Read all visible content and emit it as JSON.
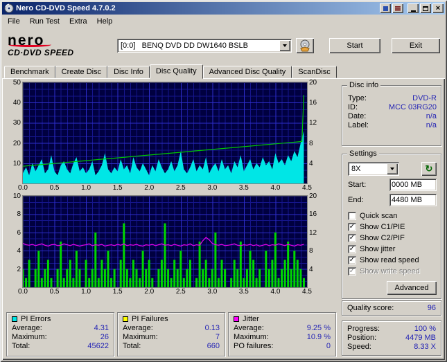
{
  "window": {
    "title": "Nero CD-DVD Speed 4.7.0.2",
    "menu": [
      "File",
      "Run Test",
      "Extra",
      "Help"
    ]
  },
  "header": {
    "logo_top": "nero",
    "logo_bottom": "CD·DVD SPEED",
    "drive": "[0:0]   BENQ DVD DD DW1640 BSLB",
    "start_label": "Start",
    "exit_label": "Exit"
  },
  "tabs": [
    "Benchmark",
    "Create Disc",
    "Disc Info",
    "Disc Quality",
    "Advanced Disc Quality",
    "ScanDisc"
  ],
  "active_tab": "Disc Quality",
  "disc_info": {
    "title": "Disc info",
    "rows": [
      [
        "Type:",
        "DVD-R"
      ],
      [
        "ID:",
        "MCC 03RG20"
      ],
      [
        "Date:",
        "n/a"
      ],
      [
        "Label:",
        "n/a"
      ]
    ]
  },
  "settings": {
    "title": "Settings",
    "speed": "8X",
    "start_label": "Start:",
    "start_value": "0000 MB",
    "end_label": "End:",
    "end_value": "4480 MB",
    "checkboxes": [
      {
        "label": "Quick scan",
        "checked": false,
        "disabled": false
      },
      {
        "label": "Show C1/PIE",
        "checked": true,
        "disabled": false
      },
      {
        "label": "Show C2/PIF",
        "checked": true,
        "disabled": false
      },
      {
        "label": "Show jitter",
        "checked": true,
        "disabled": false
      },
      {
        "label": "Show read speed",
        "checked": true,
        "disabled": false
      },
      {
        "label": "Show write speed",
        "checked": true,
        "disabled": true
      }
    ],
    "advanced_label": "Advanced"
  },
  "quality": {
    "label": "Quality score:",
    "value": "96"
  },
  "progress": {
    "rows": [
      [
        "Progress:",
        "100 %"
      ],
      [
        "Position:",
        "4479 MB"
      ],
      [
        "Speed:",
        "8.33 X"
      ]
    ]
  },
  "stats": [
    {
      "color": "#00e6e6",
      "title": "PI Errors",
      "rows": [
        [
          "Average:",
          "4.31"
        ],
        [
          "Maximum:",
          "26"
        ],
        [
          "Total:",
          "45622"
        ]
      ]
    },
    {
      "color": "#ffff00",
      "title": "PI Failures",
      "rows": [
        [
          "Average:",
          "0.13"
        ],
        [
          "Maximum:",
          "7"
        ],
        [
          "Total:",
          "660"
        ]
      ]
    },
    {
      "color": "#ff00ff",
      "title": "Jitter",
      "rows": [
        [
          "Average:",
          "9.25 %"
        ],
        [
          "Maximum:",
          "10.9 %"
        ],
        [
          "PO failures:",
          "0"
        ]
      ]
    }
  ],
  "chart_data": [
    {
      "type": "area",
      "name": "pi-errors-chart",
      "x_range": [
        0,
        4.5
      ],
      "x_data_max": 4.45,
      "x_ticks": [
        "0.0",
        "0.5",
        "1.0",
        "1.5",
        "2.0",
        "2.5",
        "3.0",
        "3.5",
        "4.0",
        "4.5"
      ],
      "left_axis": {
        "max": 50,
        "ticks": [
          50,
          40,
          30,
          20,
          10
        ]
      },
      "right_axis": {
        "max": 20,
        "ticks": [
          20,
          16,
          12,
          8,
          4
        ]
      },
      "grid": true,
      "series": [
        {
          "name": "PI Errors",
          "type": "area",
          "axis": "left",
          "color": "#00e6e6",
          "values": [
            5,
            8,
            4,
            10,
            6,
            9,
            12,
            5,
            7,
            14,
            6,
            4,
            9,
            11,
            7,
            5,
            10,
            13,
            6,
            8,
            5,
            7,
            11,
            4,
            6,
            9,
            15,
            7,
            5,
            8,
            6,
            12,
            7,
            9,
            5,
            13,
            8,
            6,
            10,
            7,
            4,
            9,
            6,
            12,
            8,
            5,
            7,
            11,
            6,
            9,
            16,
            7,
            5,
            8,
            12,
            6,
            9,
            7,
            13,
            5,
            8,
            10,
            6,
            12,
            7,
            9,
            5,
            11,
            8,
            14,
            6,
            9,
            12,
            7,
            10,
            8,
            13,
            9,
            11,
            7,
            15,
            10,
            12,
            9,
            14,
            11,
            16,
            13,
            20,
            26
          ]
        },
        {
          "name": "Read speed",
          "type": "line",
          "axis": "right",
          "color": "#00c800",
          "x": [
            0,
            0.25,
            0.5,
            0.75,
            1,
            1.25,
            1.5,
            1.75,
            2,
            2.25,
            2.5,
            2.75,
            3,
            3.25,
            3.5,
            3.75,
            4,
            4.2,
            4.35,
            4.42,
            4.45
          ],
          "values": [
            3.4,
            3.68,
            3.95,
            4.23,
            4.51,
            4.79,
            5.06,
            5.34,
            5.62,
            5.89,
            6.17,
            6.45,
            6.73,
            7.0,
            7.28,
            7.56,
            7.83,
            8.06,
            8.22,
            8.3,
            17.5
          ]
        }
      ]
    },
    {
      "type": "bar",
      "name": "pi-failures-chart",
      "x_range": [
        0,
        4.5
      ],
      "x_data_max": 4.45,
      "x_ticks": [
        "0.0",
        "0.5",
        "1.0",
        "1.5",
        "2.0",
        "2.5",
        "3.0",
        "3.5",
        "4.0",
        "4.5"
      ],
      "left_axis": {
        "max": 10,
        "ticks": [
          10,
          8,
          6,
          4,
          2
        ]
      },
      "right_axis": {
        "max": 20,
        "ticks": [
          20,
          16,
          12,
          8,
          4
        ]
      },
      "grid": true,
      "series": [
        {
          "name": "PI Failures",
          "type": "bar",
          "axis": "left",
          "color": "#00d800",
          "values": [
            2,
            1,
            3,
            0,
            2,
            4,
            1,
            2,
            3,
            1,
            0,
            2,
            5,
            1,
            2,
            3,
            1,
            4,
            2,
            0,
            3,
            1,
            2,
            6,
            1,
            3,
            2,
            4,
            1,
            2,
            0,
            3,
            7,
            2,
            1,
            3,
            2,
            1,
            4,
            2,
            3,
            1,
            0,
            2,
            3,
            7,
            2,
            1,
            3,
            2,
            4,
            1,
            2,
            3,
            0,
            1,
            5,
            2,
            3,
            1,
            2,
            6,
            1,
            3,
            2,
            0,
            1,
            3,
            2,
            5,
            1,
            2,
            4,
            3,
            1,
            2,
            0,
            4,
            2,
            3,
            6,
            1,
            2,
            3,
            5,
            2,
            4,
            3,
            2,
            1
          ]
        },
        {
          "name": "Jitter",
          "type": "line",
          "axis": "right",
          "color": "#f000f0",
          "values": [
            9.6,
            9.3,
            9.2,
            9.4,
            9.1,
            9.3,
            9.5,
            9.2,
            9.0,
            9.3,
            9.4,
            9.1,
            9.2,
            9.5,
            9.3,
            9.1,
            9.4,
            9.2,
            9.0,
            9.2,
            9.3,
            9.5,
            9.1,
            9.3,
            9.2,
            9.4,
            9.0,
            9.2,
            9.3,
            9.1,
            9.4,
            9.2,
            9.5,
            9.1,
            9.3,
            9.2,
            9.4,
            9.1,
            9.0,
            9.3,
            9.2,
            9.4,
            9.1,
            9.3,
            9.5,
            9.2,
            9.3,
            9.1,
            9.4,
            9.2,
            9.0,
            9.3,
            9.2,
            9.5,
            9.1,
            9.3,
            9.2,
            10.2,
            10.9,
            10.4,
            9.6,
            9.3,
            9.2,
            9.4,
            9.1,
            9.2,
            9.3,
            9.5,
            9.2,
            9.1,
            9.3,
            9.2,
            9.4,
            9.1,
            9.3,
            9.0,
            9.2,
            9.4,
            9.1,
            9.3,
            9.2,
            9.5,
            9.3,
            9.1,
            9.4,
            9.2,
            9.0,
            9.3,
            9.2,
            9.4
          ]
        }
      ]
    }
  ],
  "colors": {
    "titlebar_start": "#0a246a",
    "titlebar_end": "#a6caf0",
    "chart_bg": "#000040",
    "grid_major": "#2e2ecc",
    "grid_minor": "#16168e",
    "value_blue": "#2424b4"
  }
}
